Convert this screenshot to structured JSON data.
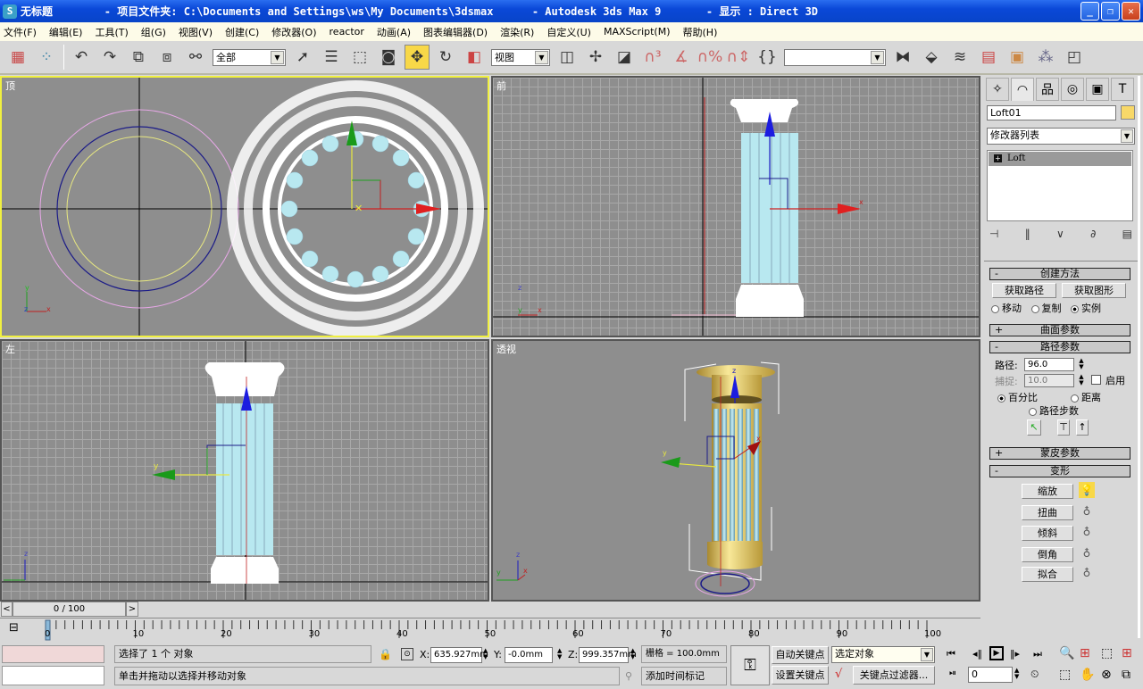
{
  "window": {
    "title": "无标题        - 项目文件夹: C:\\Documents and Settings\\ws\\My Documents\\3dsmax      - Autodesk 3ds Max 9       - 显示 : Direct 3D",
    "minimize": "_",
    "restore": "❐",
    "close": "✕"
  },
  "menu": [
    "文件(F)",
    "编辑(E)",
    "工具(T)",
    "组(G)",
    "视图(V)",
    "创建(C)",
    "修改器(O)",
    "reactor",
    "动画(A)",
    "图表编辑器(D)",
    "渲染(R)",
    "自定义(U)",
    "MAXScript(M)",
    "帮助(H)"
  ],
  "toolbar": {
    "selection_filter": "全部",
    "ref_coord": "视图",
    "named_selection": ""
  },
  "viewports": {
    "top": "顶",
    "front": "前",
    "left": "左",
    "perspective": "透视"
  },
  "command_panel": {
    "object_name": "Loft01",
    "object_color": "#f8d868",
    "modifier_list": "修改器列表",
    "stack_item": "Loft",
    "creation_method": {
      "title": "创建方法",
      "get_path": "获取路径",
      "get_shape": "获取图形",
      "move": "移动",
      "copy": "复制",
      "instance": "实例",
      "selected": "instance"
    },
    "surface_params": "曲面参数",
    "path_params": {
      "title": "路径参数",
      "path_label": "路径:",
      "path_value": "96.0",
      "snap_label": "捕捉:",
      "snap_value": "10.0",
      "enable": "启用",
      "enable_checked": false,
      "percentage": "百分比",
      "distance": "距离",
      "path_steps": "路径步数",
      "selected": "percentage"
    },
    "skin_params": "蒙皮参数",
    "deformations": {
      "title": "变形",
      "items": [
        {
          "label": "缩放",
          "active": true
        },
        {
          "label": "扭曲",
          "active": false
        },
        {
          "label": "倾斜",
          "active": false
        },
        {
          "label": "倒角",
          "active": false
        },
        {
          "label": "拟合",
          "active": false
        }
      ]
    }
  },
  "timeline": {
    "slider": "0 / 100",
    "current_frame": 0,
    "total_frames": 100,
    "ticks": [
      "0",
      "10",
      "20",
      "30",
      "40",
      "50",
      "60",
      "70",
      "80",
      "90",
      "100"
    ]
  },
  "status": {
    "selection": "选择了 1 个 对象",
    "prompt": "单击并拖动以选择并移动对象",
    "x_label": "X:",
    "x": "635.927mm",
    "y_label": "Y:",
    "y": "-0.0mm",
    "z_label": "Z:",
    "z": "999.357mm",
    "grid": "栅格 = 100.0mm",
    "add_time_tag": "添加时间标记",
    "auto_key": "自动关键点",
    "set_key": "设置关键点",
    "key_mode": "选定对象",
    "key_filters": "关键点过滤器...",
    "frame": "0"
  }
}
